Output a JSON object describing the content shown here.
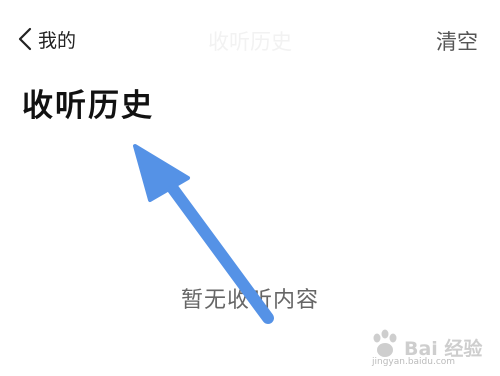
{
  "nav": {
    "back_label": "我的",
    "title": "收听历史",
    "clear_label": "清空"
  },
  "page": {
    "title": "收听历史",
    "empty_message": "暂无收听内容"
  },
  "colors": {
    "arrow": "#5592e6",
    "text": "#222222",
    "muted": "#666666"
  },
  "watermark": {
    "brand": "Bai 经验",
    "url": "jingyan.baidu.com"
  }
}
